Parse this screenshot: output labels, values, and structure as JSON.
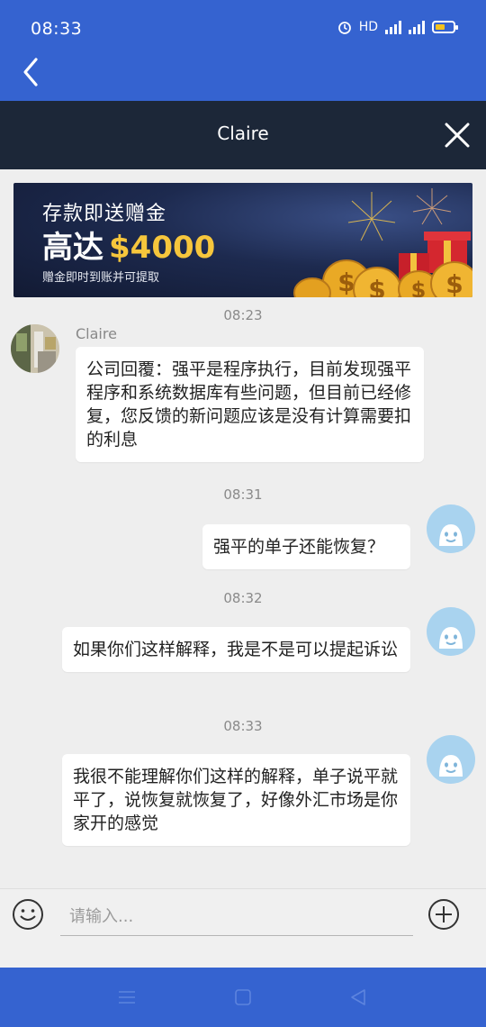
{
  "status_bar": {
    "time": "08:33",
    "network_label": "HD",
    "colors": {
      "bg": "#3563d0",
      "battery": "#f4c21c"
    }
  },
  "header": {
    "title": "Claire",
    "back_icon": "chevron-left-icon",
    "close_icon": "close-icon",
    "colors": {
      "title_bar": "#1c2738"
    }
  },
  "banner": {
    "line1": "存款即送赠金",
    "line2_prefix": "高达",
    "line2_amount": "$4000",
    "line3": "赠金即时到账并可提取"
  },
  "messages": [
    {
      "time": "08:23"
    },
    {
      "sender": "Claire",
      "direction": "incoming",
      "text": "公司回覆：强平是程序执行，目前发现强平程序和系统数据库有些问题，但目前已经修复，您反馈的新问题应该是没有计算需要扣的利息"
    },
    {
      "time": "08:31"
    },
    {
      "direction": "outgoing",
      "text": "强平的单子还能恢复？"
    },
    {
      "time": "08:32"
    },
    {
      "direction": "outgoing",
      "text": "如果你们这样解释，我是不是可以提起诉讼"
    },
    {
      "time": "08:33"
    },
    {
      "direction": "outgoing",
      "text": "我很不能理解你们这样的解释，单子说平就平了，说恢复就恢复了，好像外汇市场是你家开的感觉"
    }
  ],
  "composer": {
    "placeholder": "请输入...",
    "emoji_icon": "smiley-icon",
    "add_icon": "plus-circle-icon"
  },
  "nav_bar": {
    "icons": [
      "menu-icon",
      "home-square-icon",
      "back-triangle-icon"
    ]
  }
}
